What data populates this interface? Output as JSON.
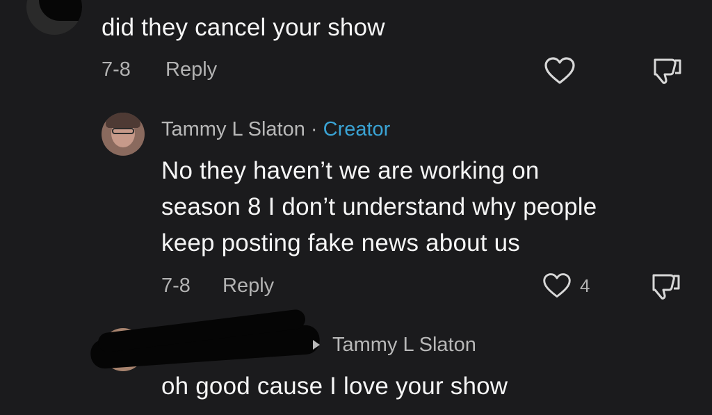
{
  "comments": [
    {
      "text": "did they cancel your show",
      "date": "7-8",
      "reply_label": "Reply"
    },
    {
      "author": "Tammy L Slaton",
      "separator": "·",
      "badge": "Creator",
      "lines": [
        "No they haven’t we are working on",
        "season 8 I don’t understand why people",
        "keep posting fake news about us"
      ],
      "date": "7-8",
      "reply_label": "Reply",
      "like_count": "4"
    },
    {
      "reply_to_author": "Tammy L Slaton",
      "text": "oh good cause I love your show"
    }
  ],
  "icons": {
    "like": "heart-icon",
    "dislike": "thumbs-down-icon",
    "reply_arrow": "caret-right-icon"
  },
  "colors": {
    "background": "#1b1b1d",
    "creator_badge": "#3aa3d4",
    "meta": "#b3b3b3"
  }
}
